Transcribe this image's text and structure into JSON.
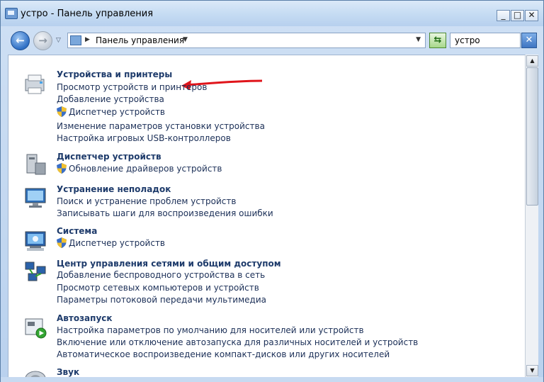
{
  "window": {
    "title": "устро - Панель управления"
  },
  "caption_buttons": {
    "minimize": "_",
    "maximize": "□",
    "close": "✕"
  },
  "addressbar": {
    "breadcrumb": "Панель управления",
    "search_value": "устро"
  },
  "groups": [
    {
      "title": "Устройства и принтеры",
      "icon": "printer-device-icon",
      "tasks": [
        {
          "label": "Просмотр устройств и принтеров",
          "shield": false
        },
        {
          "label": "Добавление устройства",
          "shield": false
        },
        {
          "label": "Диспетчер устройств",
          "shield": true
        },
        {
          "label": "Изменение параметров установки устройства",
          "shield": false
        },
        {
          "label": "Настройка игровых USB-контроллеров",
          "shield": false
        }
      ]
    },
    {
      "title": "Диспетчер устройств",
      "icon": "device-manager-icon",
      "tasks": [
        {
          "label": "Обновление драйверов устройств",
          "shield": true
        }
      ]
    },
    {
      "title": "Устранение неполадок",
      "icon": "troubleshooting-icon",
      "tasks": [
        {
          "label": "Поиск и устранение проблем устройств",
          "shield": false
        },
        {
          "label": "Записывать шаги для воспроизведения ошибки",
          "shield": false
        }
      ]
    },
    {
      "title": "Система",
      "icon": "system-icon",
      "tasks": [
        {
          "label": "Диспетчер устройств",
          "shield": true
        }
      ]
    },
    {
      "title": "Центр управления сетями и общим доступом",
      "icon": "network-center-icon",
      "tasks": [
        {
          "label": "Добавление беспроводного устройства в сеть",
          "shield": false
        },
        {
          "label": "Просмотр сетевых компьютеров и устройств",
          "shield": false
        },
        {
          "label": "Параметры потоковой передачи мультимедиа",
          "shield": false
        }
      ]
    },
    {
      "title": "Автозапуск",
      "icon": "autoplay-icon",
      "tasks": [
        {
          "label": "Настройка параметров по умолчанию для носителей или устройств",
          "shield": false
        },
        {
          "label": "Включение или отключение автозапуска для различных носителей и устройств",
          "shield": false
        },
        {
          "label": "Автоматическое воспроизведение компакт-дисков или других носителей",
          "shield": false
        }
      ]
    },
    {
      "title": "Звук",
      "icon": "sound-icon",
      "tasks": []
    }
  ],
  "colors": {
    "group_title": "#1e3b6b",
    "task_link": "#1b2f57",
    "annotation_arrow": "#e0151b"
  }
}
